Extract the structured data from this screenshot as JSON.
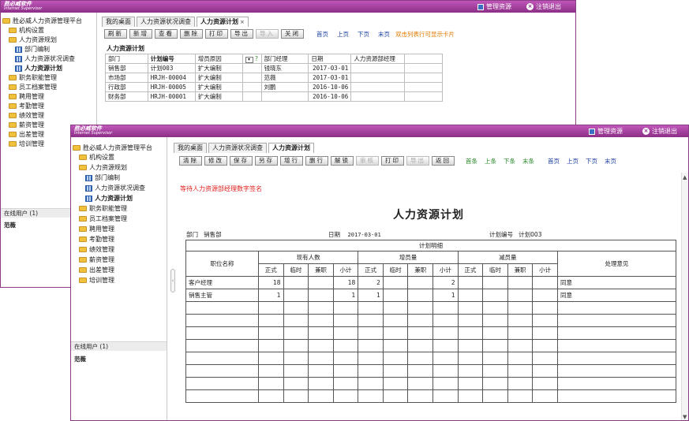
{
  "app": {
    "logo_line1": "胜必威软件",
    "logo_line2": "Internet Supervisor",
    "manage_link": "管理资源",
    "logout_link": "注销退出"
  },
  "sidebar": {
    "root": "胜必威人力资源管理平台",
    "items": [
      "机构设置",
      "人力资源规划",
      "部门编制",
      "人力资源状况调查",
      "人力资源计划",
      "职务职能管理",
      "员工档案管理",
      "聘用管理",
      "考勤管理",
      "绩效管理",
      "薪资管理",
      "出差管理",
      "培训管理"
    ],
    "online_label": "在线用户",
    "online_count": "(1)",
    "online_user": "范薇"
  },
  "back": {
    "tabs": [
      "我的桌面",
      "人力资源状况调查",
      "人力资源计划"
    ],
    "tab_close": "×",
    "buttons": [
      "刷新",
      "新增",
      "查看",
      "删除",
      "打印",
      "导出",
      "导入",
      "关闭"
    ],
    "nav": [
      "首页",
      "上页",
      "下页",
      "末页"
    ],
    "hint": "双击列表行可显示卡片",
    "panel_title": "人力资源计划",
    "columns": [
      "部门",
      "计划编号",
      "增员原因",
      "",
      "部门经理",
      "日期",
      "人力资源部经理"
    ],
    "help_mark": "?",
    "rows": [
      [
        "销售部",
        "计划003",
        "扩大编制",
        "",
        "钱晓东",
        "2017-03-01",
        ""
      ],
      [
        "市场部",
        "HRJH-00004",
        "扩大编制",
        "",
        "范薇",
        "2017-03-01",
        ""
      ],
      [
        "行政部",
        "HRJH-00005",
        "扩大编制",
        "",
        "刘鹏",
        "2016-10-06",
        ""
      ],
      [
        "财务部",
        "HRJH-00001",
        "扩大编制",
        "",
        "",
        "2016-10-06",
        ""
      ]
    ]
  },
  "front": {
    "tabs": [
      "我的桌面",
      "人力资源状况调查",
      "人力资源计划"
    ],
    "buttons": [
      "清除",
      "修改",
      "保存",
      "另存",
      "增行",
      "删行",
      "解锁",
      "审核",
      "打印",
      "导出",
      "返回"
    ],
    "record_nav": [
      "首条",
      "上条",
      "下条",
      "末条"
    ],
    "page_nav": [
      "首页",
      "上页",
      "下页",
      "末页"
    ],
    "warning": "等待人力资源部经理数字签名",
    "doc_title": "人力资源计划",
    "dept_label": "部门",
    "dept_value": "销售部",
    "date_label": "日期",
    "date_value": "2017-03-01",
    "planno_label": "计划编号",
    "planno_value": "计划003",
    "detail_header": "计划明细",
    "col_position": "职位名称",
    "col_current": "现有人数",
    "col_increase": "增员量",
    "col_decrease": "减员量",
    "col_opinion": "处理意见",
    "sub_cols": [
      "正式",
      "临时",
      "兼职",
      "小计"
    ],
    "rows": [
      {
        "name": "客户经理",
        "cur": [
          "18",
          "",
          "",
          "18"
        ],
        "inc": [
          "2",
          "",
          "",
          "2"
        ],
        "dec": [
          "",
          "",
          "",
          ""
        ],
        "opinion": "同意"
      },
      {
        "name": "销售主管",
        "cur": [
          "1",
          "",
          "",
          "1"
        ],
        "inc": [
          "1",
          "",
          "",
          "1"
        ],
        "dec": [
          "",
          "",
          "",
          ""
        ],
        "opinion": "同意"
      }
    ]
  }
}
